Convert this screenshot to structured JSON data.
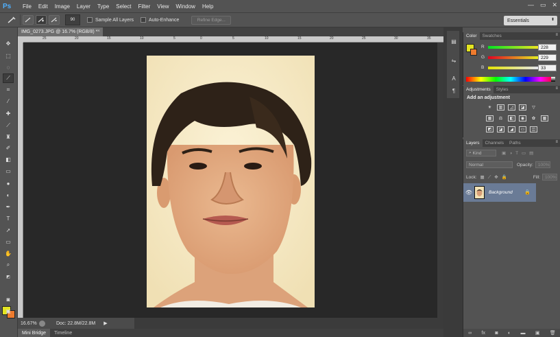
{
  "app": {
    "logo": "Ps"
  },
  "menu": [
    "File",
    "Edit",
    "Image",
    "Layer",
    "Type",
    "Select",
    "Filter",
    "View",
    "Window",
    "Help"
  ],
  "window_controls": {
    "minimize": "—",
    "restore": "▭",
    "close": "✕"
  },
  "options": {
    "brush_size": "90",
    "sample_all_layers": "Sample All Layers",
    "auto_enhance": "Auto-Enhance",
    "refine_edge": "Refine Edge...",
    "workspace": "Essentials"
  },
  "document": {
    "tab_title": "IMG_0273.JPG @ 16.7% (RGB/8) *",
    "close": "×"
  },
  "ruler": {
    "h_labels": [
      "25",
      "20",
      "15",
      "10",
      "5",
      "0",
      "5",
      "10",
      "15",
      "20",
      "25",
      "30",
      "35"
    ]
  },
  "status": {
    "zoom": "16.67%",
    "doc": "Doc: 22.8M/22.8M",
    "arrow": "▶"
  },
  "bottom_tabs": [
    "Mini Bridge",
    "Timeline"
  ],
  "color_panel": {
    "tabs": [
      "Color",
      "Swatches"
    ],
    "rows": [
      {
        "label": "R",
        "value": "228"
      },
      {
        "label": "G",
        "value": "229"
      },
      {
        "label": "B",
        "value": "33"
      }
    ],
    "foreground": "#e4e521",
    "background": "#ee7b2e"
  },
  "adjustments": {
    "tabs": [
      "Adjustments",
      "Styles"
    ],
    "title": "Add an adjustment"
  },
  "layers": {
    "tabs": [
      "Layers",
      "Channels",
      "Paths"
    ],
    "kind": "Kind",
    "blend_mode": "Normal",
    "opacity_label": "Opacity:",
    "opacity_value": "100%",
    "lock_label": "Lock:",
    "fill_label": "Fill:",
    "fill_value": "100%",
    "layer_name": "Background"
  }
}
